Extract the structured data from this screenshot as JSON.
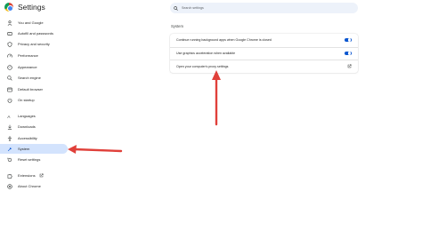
{
  "app": {
    "title": "Settings"
  },
  "search": {
    "placeholder": "Search settings"
  },
  "sidebar": {
    "items": [
      {
        "label": "You and Google",
        "icon": "person-icon"
      },
      {
        "label": "Autofill and passwords",
        "icon": "autofill-icon"
      },
      {
        "label": "Privacy and security",
        "icon": "shield-icon"
      },
      {
        "label": "Performance",
        "icon": "speedometer-icon"
      },
      {
        "label": "Appearance",
        "icon": "palette-icon"
      },
      {
        "label": "Search engine",
        "icon": "search-icon"
      },
      {
        "label": "Default browser",
        "icon": "browser-icon"
      },
      {
        "label": "On startup",
        "icon": "power-icon"
      },
      {
        "label": "Languages",
        "icon": "language-icon"
      },
      {
        "label": "Downloads",
        "icon": "download-icon"
      },
      {
        "label": "Accessibility",
        "icon": "accessibility-icon"
      },
      {
        "label": "System",
        "icon": "wrench-icon",
        "active": true
      },
      {
        "label": "Reset settings",
        "icon": "reset-icon"
      },
      {
        "label": "Extensions",
        "icon": "puzzle-icon"
      },
      {
        "label": "About Chrome",
        "icon": "chrome-icon"
      }
    ]
  },
  "main": {
    "section_title": "System",
    "rows": [
      {
        "label": "Continue running background apps when Google Chrome is closed",
        "control": "toggle",
        "checked": true
      },
      {
        "label": "Use graphics acceleration when available",
        "control": "toggle",
        "checked": true
      },
      {
        "label": "Open your computer's proxy settings",
        "control": "open-in-new-icon"
      }
    ]
  },
  "colors": {
    "accent": "#0b57d0",
    "active_bg": "#d3e3fd",
    "search_bg": "#edf2fa",
    "arrow": "#e0403a"
  }
}
